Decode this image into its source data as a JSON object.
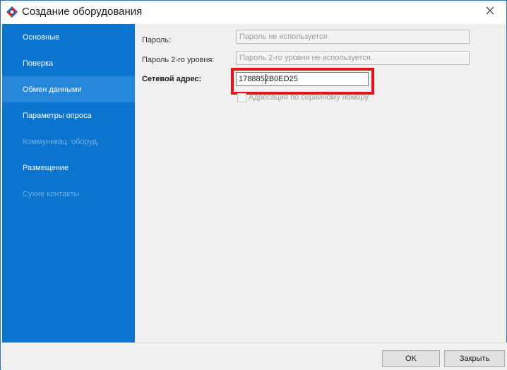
{
  "window": {
    "title": "Создание оборудования",
    "icon": "app-logo-icon",
    "close_icon": "close-icon"
  },
  "sidebar": {
    "items": [
      {
        "label": "Основные",
        "state": "normal"
      },
      {
        "label": "Поверка",
        "state": "normal"
      },
      {
        "label": "Обмен данными",
        "state": "selected"
      },
      {
        "label": "Параметры опроса",
        "state": "normal"
      },
      {
        "label": "Коммуникац. оборуд.",
        "state": "disabled"
      },
      {
        "label": "Размещение",
        "state": "normal"
      },
      {
        "label": "Сухие контакты",
        "state": "disabled"
      }
    ]
  },
  "form": {
    "password": {
      "label": "Пароль:",
      "placeholder": "Пароль не используется."
    },
    "password2": {
      "label": "Пароль 2-го уровня:",
      "placeholder": "Пароль 2-го уровня не используется."
    },
    "network_address": {
      "label": "Сетевой адрес:",
      "value": "1788852B0ED25"
    },
    "serial_addressing": {
      "label": "Адресация по серийному номеру",
      "checked": false,
      "enabled": false
    }
  },
  "buttons": {
    "ok": "OK",
    "close": "Закрыть"
  },
  "colors": {
    "sidebar": "#0a74cf",
    "sidebar_selected": "#2686d9",
    "highlight": "#e3141b"
  }
}
